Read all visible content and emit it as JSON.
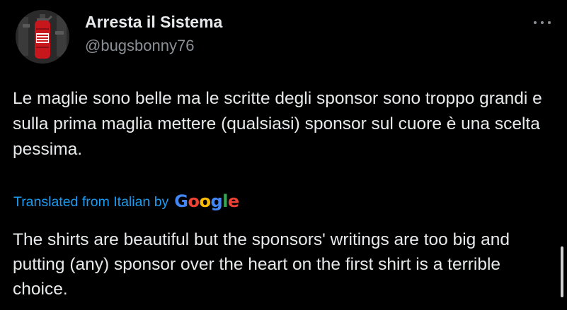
{
  "tweet": {
    "author": {
      "display_name": "Arresta il Sistema",
      "handle": "@bugsbonny76",
      "avatar_icon": "fire-extinguisher-avatar"
    },
    "more_icon": "more-dots-icon",
    "original_text": "Le maglie sono belle ma le scritte degli sponsor sono troppo grandi e sulla prima maglia mettere (qualsiasi) sponsor sul cuore è una scelta pessima.",
    "translation": {
      "label": "Translated from Italian by",
      "provider_letters": [
        "G",
        "o",
        "o",
        "g",
        "l",
        "e"
      ],
      "text": "The shirts are beautiful but the sponsors' writings are too big and putting (any) sponsor over the heart on the first shirt is a terrible choice."
    }
  },
  "colors": {
    "background": "#000000",
    "primary_text": "#e7e9ea",
    "secondary_text": "#8b9096",
    "link": "#1d9bf0",
    "google_blue": "#4285f4",
    "google_red": "#ea4335",
    "google_yellow": "#fbbc05",
    "google_green": "#34a853"
  }
}
